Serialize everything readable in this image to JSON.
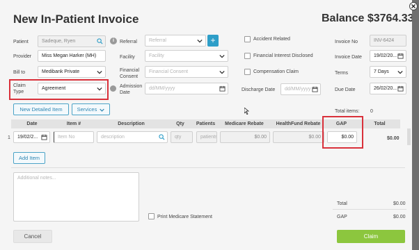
{
  "header": {
    "title": "New In-Patient Invoice",
    "balance": "Balance $3764.33"
  },
  "left": {
    "patient_label": "Patient",
    "patient_value": "Sadeque, Ryen",
    "provider_label": "Provider",
    "provider_value": "Miss Megan Harker (MH)",
    "billto_label": "Bill to",
    "billto_value": "Medibank Private",
    "claimtype_label_1": "Claim",
    "claimtype_label_2": "Type",
    "claimtype_value": "Agreement"
  },
  "mid": {
    "referral_label": "Referral",
    "referral_placeholder": "Referral",
    "facility_label": "Facility",
    "facility_placeholder": "Facility",
    "consent_label_1": "Financial",
    "consent_label_2": "Consent",
    "consent_placeholder": "Financial Consent",
    "admission_label_1": "Admission",
    "admission_label_2": "Date",
    "admission_placeholder": "dd/MM/yyyy"
  },
  "checks": {
    "accident": "Accident Related",
    "financial_interest": "Financial Interest Disclosed",
    "compensation": "Compensation Claim",
    "discharge_label": "Discharge Date",
    "discharge_placeholder": "dd/MM/yyyy"
  },
  "right": {
    "invoice_no_label": "Invoice No",
    "invoice_no_value": "INV-6424",
    "invoice_date_label": "Invoice Date",
    "invoice_date_value": "19/02/20...",
    "terms_label": "Terms",
    "terms_value": "7 Days",
    "due_date_label": "Due Date",
    "due_date_value": "26/02/20..."
  },
  "actions": {
    "new_detailed_item": "New Detailed Item",
    "services": "Services",
    "total_items_label": "Total items:",
    "total_items_value": "0"
  },
  "table": {
    "headers": [
      "Date",
      "Item #",
      "Description",
      "Qty",
      "Patients",
      "Medicare Rebate",
      "HealthFund Rebate",
      "GAP",
      "Total"
    ],
    "row": {
      "num": "1",
      "date": "19/02/2...",
      "item_placeholder": "Item No",
      "desc_placeholder": "description",
      "qty": "qty",
      "patients": "patients",
      "medicare": "$0.00",
      "healthfund": "$0.00",
      "gap": "$0.00",
      "total": "$0.00"
    }
  },
  "add_item": "Add Item",
  "notes_placeholder": "Additional notes...",
  "print_medicare": "Print Medicare Statement",
  "totals": {
    "total_label": "Total",
    "total_value": "$0.00",
    "gap_label": "GAP",
    "gap_value": "$0.00"
  },
  "footer": {
    "cancel": "Cancel",
    "claim": "Claim"
  },
  "colors": {
    "accent": "#2e9ec8",
    "claim_green": "#8cc63e",
    "highlight_red": "#d9303a"
  }
}
